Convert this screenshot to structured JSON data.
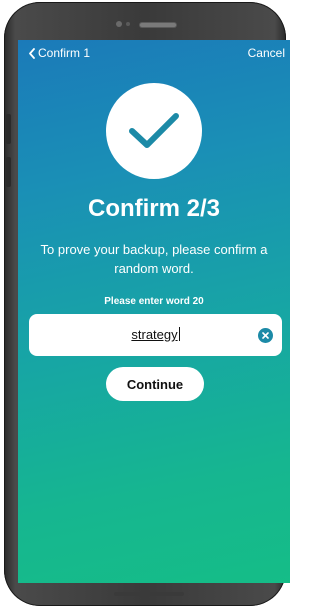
{
  "nav": {
    "back_label": "Confirm 1",
    "back_icon": "chevron-left-icon",
    "cancel_label": "Cancel"
  },
  "hero": {
    "icon": "checkmark-icon",
    "title": "Confirm 2/3",
    "description": "To prove your backup, please confirm a random word."
  },
  "form": {
    "prompt": "Please enter word 20",
    "word_value": "strategy",
    "clear_icon": "clear-icon"
  },
  "actions": {
    "continue_label": "Continue"
  },
  "colors": {
    "gradient_top": "#1b7ab9",
    "gradient_bottom": "#15bd87",
    "check_accent": "#1c8aa7"
  }
}
